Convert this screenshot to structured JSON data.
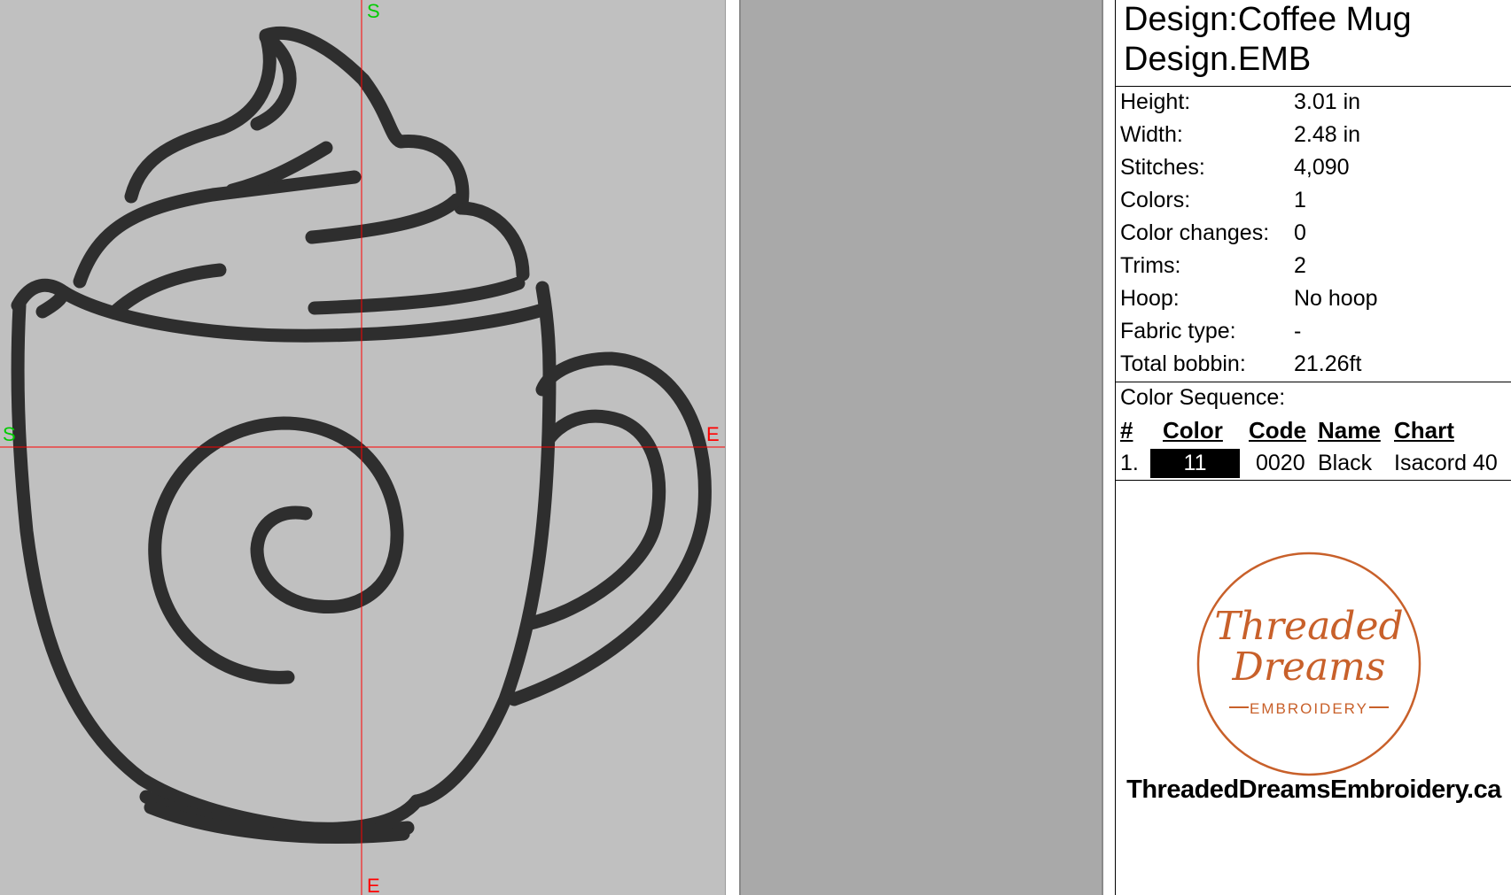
{
  "design": {
    "title_line1": "Design:Coffee Mug",
    "title_line2": "Design.EMB"
  },
  "properties": [
    {
      "label": "Height:",
      "value": "3.01 in"
    },
    {
      "label": "Width:",
      "value": "2.48 in"
    },
    {
      "label": "Stitches:",
      "value": "4,090"
    },
    {
      "label": "Colors:",
      "value": "1"
    },
    {
      "label": "Color changes:",
      "value": "0"
    },
    {
      "label": "Trims:",
      "value": "2"
    },
    {
      "label": "Hoop:",
      "value": "No hoop"
    },
    {
      "label": "Fabric type:",
      "value": "-"
    },
    {
      "label": "Total bobbin:",
      "value": "21.26ft"
    }
  ],
  "color_sequence": {
    "title": "Color Sequence:",
    "headers": {
      "num": "#",
      "color": "Color",
      "code": "Code",
      "name": "Name",
      "chart": "Chart"
    },
    "rows": [
      {
        "num": "1.",
        "color_label": "11",
        "swatch": "#000000",
        "code": "0020",
        "name": "Black",
        "chart": "Isacord 40"
      }
    ]
  },
  "canvas": {
    "start_marker": "S",
    "end_marker": "E",
    "background": "#c0c0c0",
    "crosshair_color": "#ff0000",
    "marker_color": "#00cc00",
    "end_color": "#ff0000",
    "stitch_color": "#2e2e2e"
  },
  "logo": {
    "line1": "Threaded",
    "line2": "Dreams",
    "line3": "EMBROIDERY",
    "color": "#c8602a"
  },
  "website": "ThreadedDreamsEmbroidery.ca"
}
